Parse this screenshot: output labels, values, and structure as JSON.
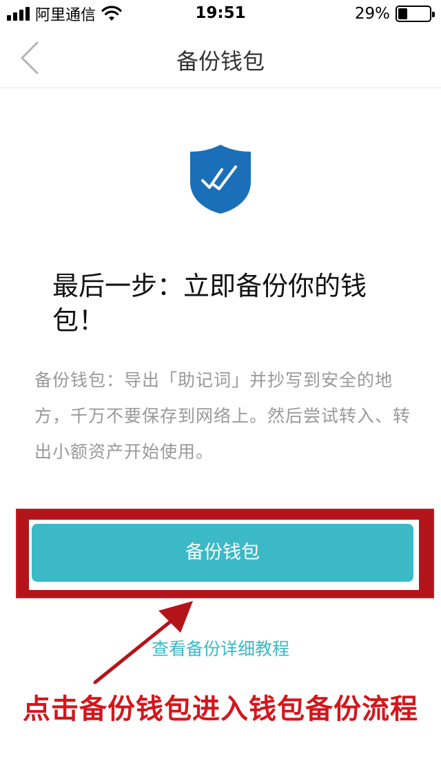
{
  "status_bar": {
    "carrier": "阿里通信",
    "time": "19:51",
    "battery": "29%",
    "battery_level": 0.29
  },
  "nav": {
    "title": "备份钱包",
    "back_icon": "chevron-left-icon"
  },
  "content": {
    "shield_icon": "shield-check-icon",
    "headline": "最后一步：立即备份你的钱包！",
    "description": "备份钱包：导出「助记词」并抄写到安全的地方，千万不要保存到网络上。然后尝试转入、转出小额资产开始使用。",
    "backup_button": "备份钱包",
    "tutorial_link": "查看备份详细教程"
  },
  "annotation": {
    "text": "点击备份钱包进入钱包备份流程",
    "color": "#d4161c"
  },
  "colors": {
    "accent": "#3bb9c6",
    "shield": "#1b6fb8"
  }
}
